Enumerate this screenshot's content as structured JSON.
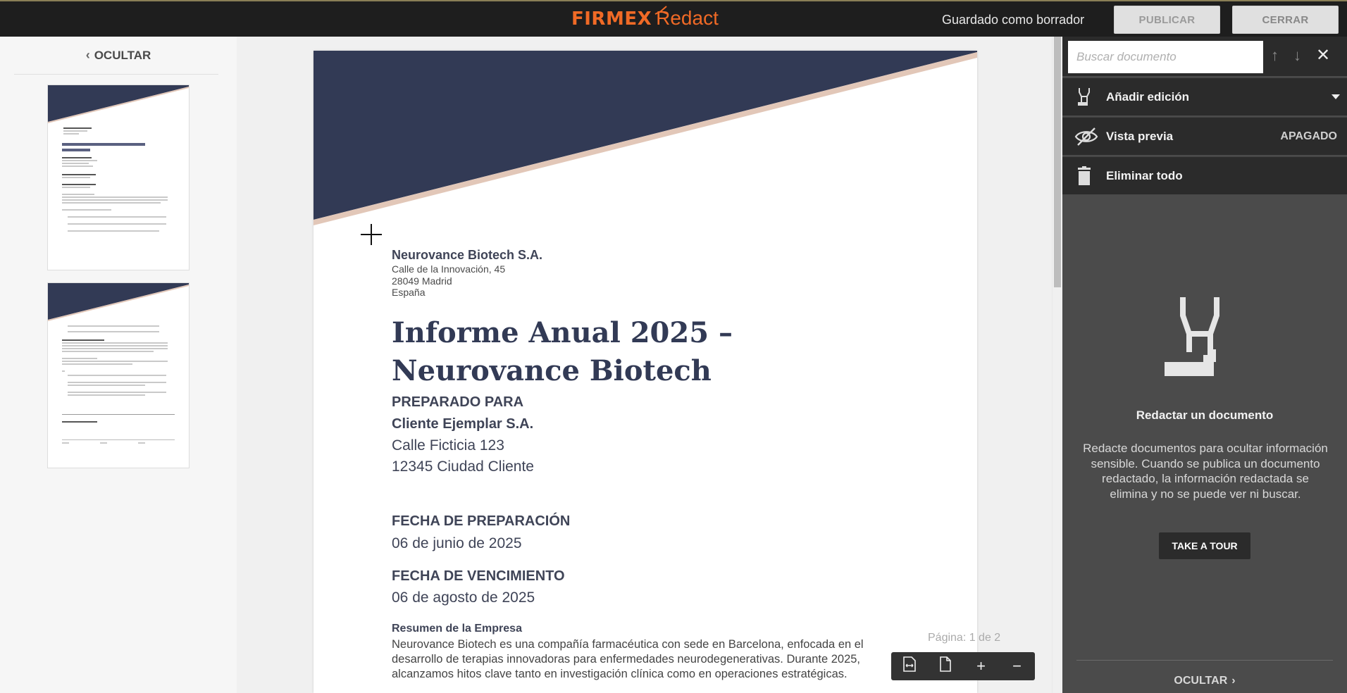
{
  "header": {
    "logo_brand": "FIRMEX",
    "logo_product": "Redact",
    "save_status": "Guardado como borrador",
    "publish_label": "PUBLICAR",
    "close_label": "CERRAR"
  },
  "left_panel": {
    "hide_label": "OCULTAR",
    "thumbnails": [
      "page-1",
      "page-2"
    ]
  },
  "document": {
    "company": "Neurovance Biotech S.A.",
    "address_line1": "Calle de la Innovación, 45",
    "address_line2": "28049 Madrid",
    "address_line3": "España",
    "title": "Informe Anual 2025 – Neurovance Biotech",
    "prepared_for_label": "PREPARADO PARA",
    "client_name": "Cliente Ejemplar S.A.",
    "client_street": "Calle Ficticia 123",
    "client_city": "12345 Ciudad Cliente",
    "prep_date_label": "FECHA DE PREPARACIÓN",
    "prep_date": "06 de junio de 2025",
    "due_date_label": "FECHA DE VENCIMIENTO",
    "due_date": "06 de agosto de 2025",
    "summary_heading": "Resumen de la Empresa",
    "summary_text": " Neurovance Biotech es una compañía farmacéutica con sede en Barcelona, enfocada en el desarrollo de terapias innovadoras para enfermedades neurodegenerativas. Durante 2025, alcanzamos hitos clave tanto en investigación clínica como en operaciones estratégicas.",
    "band_color": "#323a55",
    "band_accent": "#e2c7b8"
  },
  "pager": {
    "text": "Página: 1 de 2"
  },
  "right_panel": {
    "search_placeholder": "Buscar documento",
    "add_redaction_label": "Añadir edición",
    "preview_label": "Vista previa",
    "preview_state": "APAGADO",
    "delete_all_label": "Eliminar todo",
    "empty_title": "Redactar un documento",
    "empty_description": "Redacte documentos para ocultar información sensible. Cuando se publica un documento redactado, la información redactada se elimina y no se puede ver ni buscar.",
    "tour_label": "TAKE A TOUR",
    "hide_label": "OCULTAR"
  }
}
